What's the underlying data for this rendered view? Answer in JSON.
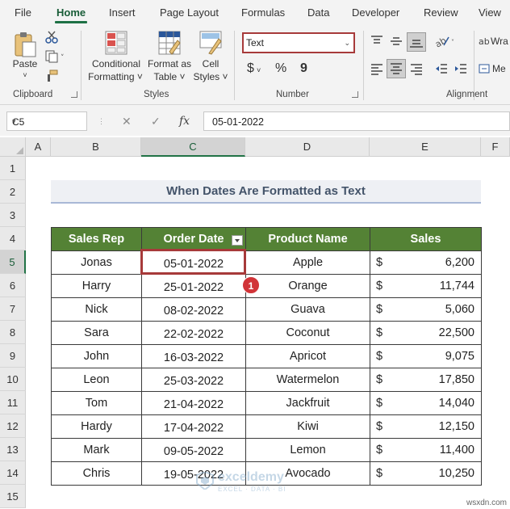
{
  "ribbon": {
    "tabs": [
      "File",
      "Home",
      "Insert",
      "Page Layout",
      "Formulas",
      "Data",
      "Developer",
      "Review",
      "View"
    ],
    "active_tab": "Home",
    "clipboard": {
      "paste": "Paste",
      "label": "Clipboard"
    },
    "styles": {
      "conditional_formatting_1": "Conditional",
      "conditional_formatting_2": "Formatting ˅",
      "format_as_table_1": "Format as",
      "format_as_table_2": "Table ˅",
      "cell_styles_1": "Cell",
      "cell_styles_2": "Styles ˅",
      "label": "Styles"
    },
    "number": {
      "format_value": "Text",
      "currency": "$",
      "percent": "%",
      "comma": "9",
      "label": "Number"
    },
    "alignment": {
      "wrap": "Wra",
      "merge": "Me",
      "label": "Alignment"
    }
  },
  "formula_bar": {
    "name_box": "C5",
    "cancel": "✕",
    "enter": "✓",
    "fx": "fx",
    "value": "05-01-2022"
  },
  "sheet": {
    "columns": [
      "A",
      "B",
      "C",
      "D",
      "E",
      "F"
    ],
    "selected_column": "C",
    "rows": [
      "1",
      "2",
      "3",
      "4",
      "5",
      "6",
      "7",
      "8",
      "9",
      "10",
      "11",
      "12",
      "13",
      "14",
      "15"
    ],
    "selected_row": "5",
    "title": "When Dates Are Formatted as Text",
    "headers": [
      "Sales Rep",
      "Order Date",
      "Product Name",
      "Sales"
    ],
    "data": [
      {
        "rep": "Jonas",
        "date": "05-01-2022",
        "product": "Apple",
        "currency": "$",
        "sales": "6,200"
      },
      {
        "rep": "Harry",
        "date": "25-01-2022",
        "product": "Orange",
        "currency": "$",
        "sales": "11,744"
      },
      {
        "rep": "Nick",
        "date": "08-02-2022",
        "product": "Guava",
        "currency": "$",
        "sales": "5,060"
      },
      {
        "rep": "Sara",
        "date": "22-02-2022",
        "product": "Coconut",
        "currency": "$",
        "sales": "22,500"
      },
      {
        "rep": "John",
        "date": "16-03-2022",
        "product": "Apricot",
        "currency": "$",
        "sales": "9,075"
      },
      {
        "rep": "Leon",
        "date": "25-03-2022",
        "product": "Watermelon",
        "currency": "$",
        "sales": "17,850"
      },
      {
        "rep": "Tom",
        "date": "21-04-2022",
        "product": "Jackfruit",
        "currency": "$",
        "sales": "14,040"
      },
      {
        "rep": "Hardy",
        "date": "17-04-2022",
        "product": "Kiwi",
        "currency": "$",
        "sales": "12,150"
      },
      {
        "rep": "Mark",
        "date": "09-05-2022",
        "product": "Lemon",
        "currency": "$",
        "sales": "11,400"
      },
      {
        "rep": "Chris",
        "date": "19-05-2022",
        "product": "Avocado",
        "currency": "$",
        "sales": "10,250"
      }
    ],
    "callout_badge": "1"
  },
  "watermark": {
    "name": "exceldemy",
    "tagline": "EXCEL · DATA · BI"
  },
  "site_credit": "wsxdn.com",
  "colors": {
    "header_green": "#548235",
    "accent_red": "#a73a3a",
    "excel_green": "#217346",
    "title_text": "#44546a"
  }
}
